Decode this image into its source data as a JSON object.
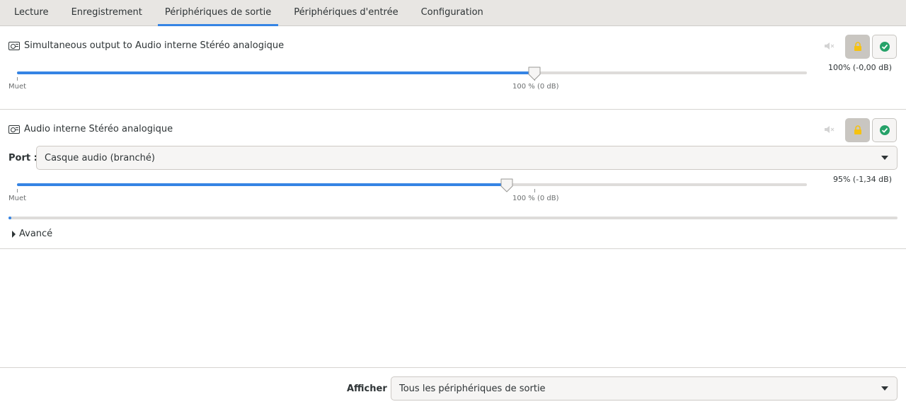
{
  "tabs": [
    {
      "label": "Lecture",
      "active": false
    },
    {
      "label": "Enregistrement",
      "active": false
    },
    {
      "label": "Périphériques de sortie",
      "active": true
    },
    {
      "label": "Périphériques d'entrée",
      "active": false
    },
    {
      "label": "Configuration",
      "active": false
    }
  ],
  "devices": [
    {
      "name": "Simultaneous output to Audio interne Stéréo analogique",
      "icon": "sound-card-icon",
      "level_text": "100% (-0,00 dB)",
      "volume_fraction": 0.655,
      "mark_min_label": "Muet",
      "mark_100_label": "100 % (0 dB)",
      "locked": true,
      "is_default": true
    },
    {
      "name": "Audio interne Stéréo analogique",
      "icon": "sound-card-icon",
      "port_label": "Port :",
      "port_value": "Casque audio (branché)",
      "level_text": "95% (-1,34 dB)",
      "volume_fraction": 0.62,
      "mark_min_label": "Muet",
      "mark_100_label": "100 % (0 dB)",
      "peak_fraction": 0.003,
      "advanced_label": "Avancé",
      "locked": true,
      "is_default": true
    }
  ],
  "footer": {
    "show_label": "Afficher :",
    "show_value": "Tous les périphériques de sortie"
  },
  "colors": {
    "accent": "#3584e4",
    "lock": "#f5c211",
    "check": "#26a269"
  }
}
